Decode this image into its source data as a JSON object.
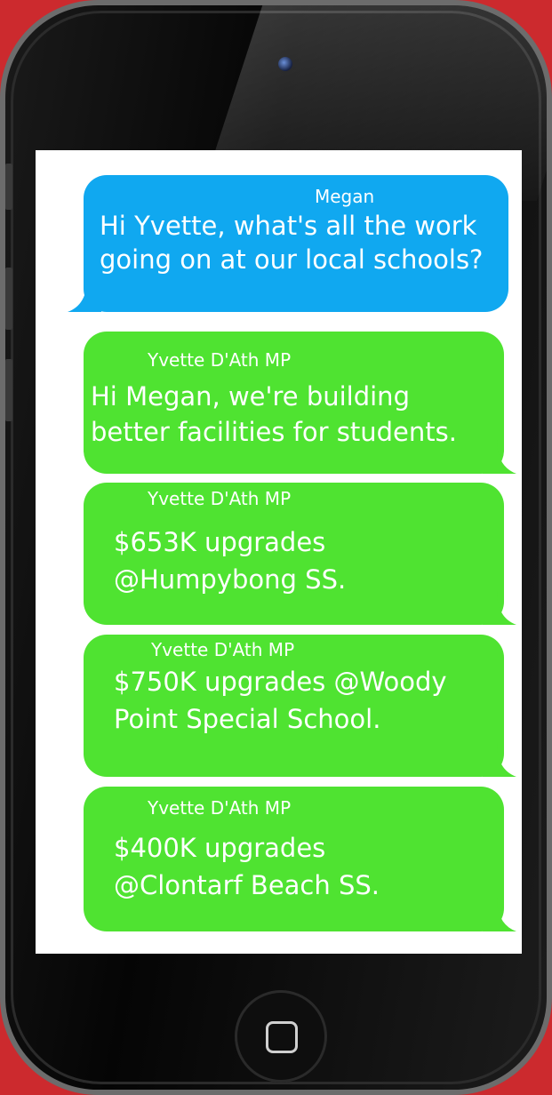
{
  "messages": [
    {
      "sender": "Megan",
      "text_lines": [
        "Hi Yvette, what's all the work",
        "going on at our local schools?"
      ],
      "color": "#10a8f0"
    },
    {
      "sender": "Yvette D'Ath MP",
      "text_lines": [
        "Hi Megan, we're building",
        "better facilities for students."
      ],
      "color": "#4fe331"
    },
    {
      "sender": "Yvette D'Ath MP",
      "text_lines": [
        "$653K upgrades",
        "@Humpybong SS."
      ],
      "color": "#4fe331"
    },
    {
      "sender": "Yvette D'Ath MP",
      "text_lines": [
        "$750K upgrades @Woody",
        "Point Special School."
      ],
      "color": "#4fe331"
    },
    {
      "sender": "Yvette D'Ath MP",
      "text_lines": [
        "$400K upgrades",
        "@Clontarf Beach SS."
      ],
      "color": "#4fe331"
    }
  ],
  "colors": {
    "background": "#cc2a2e",
    "outgoing_bubble": "#10a8f0",
    "incoming_bubble": "#4fe331"
  },
  "icons": {
    "camera": "front-camera-icon",
    "home": "home-button-icon"
  }
}
